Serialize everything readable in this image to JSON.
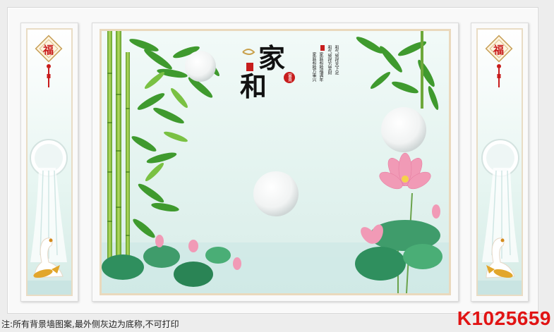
{
  "artwork": {
    "fu_char": "福",
    "title_jia": "家",
    "title_he": "和",
    "seal_fugui": "富貴",
    "poem_lines": [
      "和气致祥天下足",
      "和气致祥万里财",
      "家庭和睦福满年",
      "家庭和睦万事兴"
    ]
  },
  "footer": {
    "note": "注:所有背景墙图案,最外侧灰边为底称,不可打印",
    "code": "K1025659"
  },
  "colors": {
    "code": "#e11414",
    "frame": "#ead9bd",
    "background": "#ededed"
  }
}
